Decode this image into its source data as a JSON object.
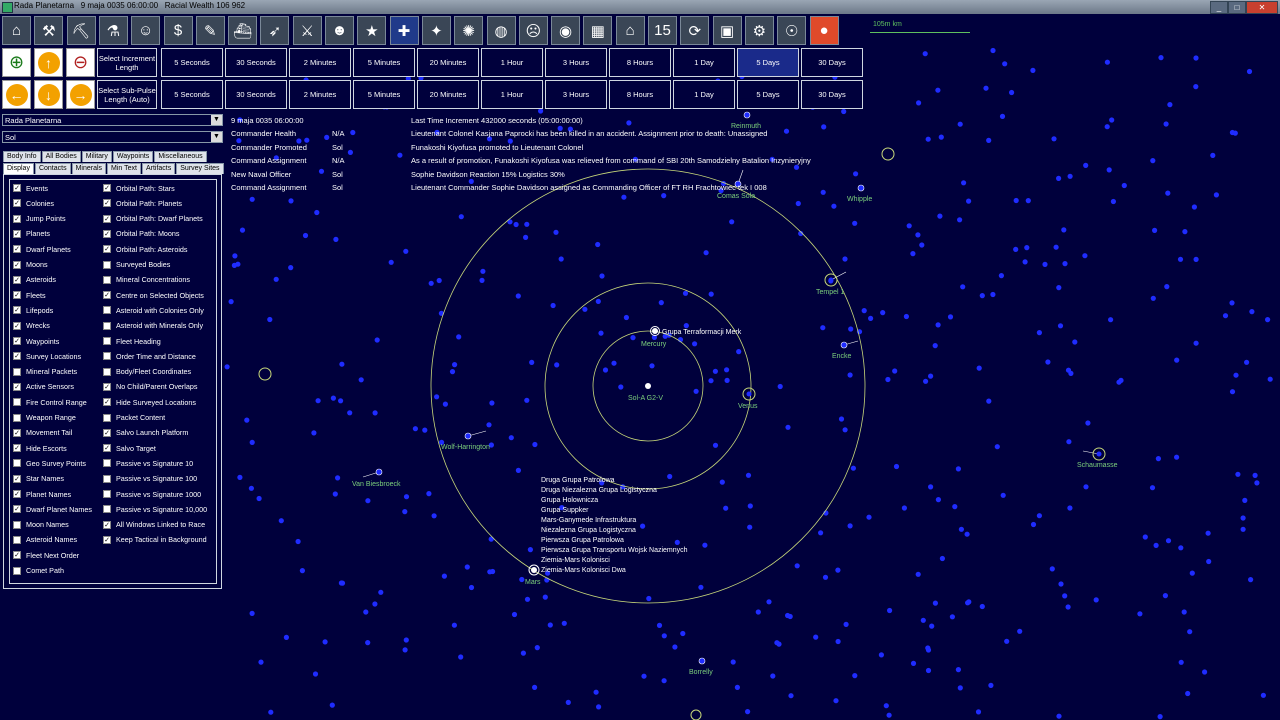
{
  "window": {
    "title": "Rada Planetarna   9 maja 0035 06:00:00   Racial Wealth 106 962",
    "controls": [
      "_",
      "□",
      "✕"
    ]
  },
  "toolbar": {
    "icons": [
      "colony-icon",
      "industry-icon",
      "mining-icon",
      "research-icon",
      "population-icon",
      "economics-icon",
      "design-icon",
      "ship-design-icon",
      "missile-icon",
      "ground-forces-icon",
      "commanders-icon",
      "medals-icon",
      "flag-icon",
      "system-map-icon",
      "galaxy-map-icon",
      "globe-icon",
      "species-icon",
      "intelligence-icon",
      "ship-card-icon",
      "academy-icon",
      "calendar-icon",
      "refresh-icon",
      "save-icon",
      "settings-icon",
      "alien-icon",
      "stop-icon"
    ],
    "glyphs": [
      "⌂",
      "⚒",
      "⛏",
      "⚗",
      "☺",
      "$",
      "✎",
      "⛴",
      "➶",
      "⚔",
      "☻",
      "★",
      "✚",
      "✦",
      "✺",
      "◍",
      "☹",
      "◉",
      "▦",
      "⌂",
      "15",
      "⟳",
      "▣",
      "⚙",
      "☉",
      "●"
    ],
    "scale_label": "105m km"
  },
  "increment_rows": [
    {
      "label": "Select Increment Length",
      "buttons": [
        "5 Seconds",
        "30 Seconds",
        "2 Minutes",
        "5 Minutes",
        "20 Minutes",
        "1 Hour",
        "3 Hours",
        "8 Hours",
        "1 Day",
        "5 Days",
        "30 Days"
      ],
      "active_index": 9
    },
    {
      "label": "Select Sub-Pulse Length (Auto)",
      "buttons": [
        "5 Seconds",
        "30 Seconds",
        "2 Minutes",
        "5 Minutes",
        "20 Minutes",
        "1 Hour",
        "3 Hours",
        "8 Hours",
        "1 Day",
        "5 Days",
        "30 Days"
      ],
      "active_index": -1
    }
  ],
  "selectors": {
    "race": "Rada Planetarna",
    "system": "Sol"
  },
  "tabs_row1": [
    "Body Info",
    "All Bodies",
    "Military",
    "Waypoints",
    "Miscellaneous"
  ],
  "tabs_row2": [
    "Display",
    "Contacts",
    "Minerals",
    "Min Text",
    "Artifacts",
    "Survey Sites"
  ],
  "display_options_col1": [
    {
      "label": "Events",
      "checked": true
    },
    {
      "label": "Colonies",
      "checked": true
    },
    {
      "label": "Jump Points",
      "checked": true
    },
    {
      "label": "Planets",
      "checked": true
    },
    {
      "label": "Dwarf Planets",
      "checked": true
    },
    {
      "label": "Moons",
      "checked": true
    },
    {
      "label": "Asteroids",
      "checked": true
    },
    {
      "label": "Fleets",
      "checked": true
    },
    {
      "label": "Lifepods",
      "checked": true
    },
    {
      "label": "Wrecks",
      "checked": true
    },
    {
      "label": "Waypoints",
      "checked": true
    },
    {
      "label": "Survey Locations",
      "checked": true
    },
    {
      "label": "Mineral Packets",
      "checked": false
    },
    {
      "label": "Active Sensors",
      "checked": true
    },
    {
      "label": "Fire Control Range",
      "checked": false
    },
    {
      "label": "Weapon Range",
      "checked": false
    },
    {
      "label": "Movement Tail",
      "checked": true
    },
    {
      "label": "Hide Escorts",
      "checked": true
    },
    {
      "label": "Geo Survey Points",
      "checked": false
    },
    {
      "label": "Star Names",
      "checked": true
    },
    {
      "label": "Planet Names",
      "checked": true
    },
    {
      "label": "Dwarf Planet Names",
      "checked": true
    },
    {
      "label": "Moon Names",
      "checked": false
    },
    {
      "label": "Asteroid Names",
      "checked": false
    },
    {
      "label": "Fleet Next Order",
      "checked": true
    },
    {
      "label": "Comet Path",
      "checked": false
    }
  ],
  "display_options_col2": [
    {
      "label": "Orbital Path: Stars",
      "checked": true
    },
    {
      "label": "Orbital Path: Planets",
      "checked": true
    },
    {
      "label": "Orbital Path: Dwarf Planets",
      "checked": true
    },
    {
      "label": "Orbital Path: Moons",
      "checked": true
    },
    {
      "label": "Orbital Path: Asteroids",
      "checked": true
    },
    {
      "label": "Surveyed Bodies",
      "checked": false
    },
    {
      "label": "Mineral Concentrations",
      "checked": false
    },
    {
      "label": "Centre on Selected Objects",
      "checked": true
    },
    {
      "label": "Asteroid with Colonies Only",
      "checked": false
    },
    {
      "label": "Asteroid with Minerals Only",
      "checked": false
    },
    {
      "label": "Fleet Heading",
      "checked": false
    },
    {
      "label": "Order Time and Distance",
      "checked": false
    },
    {
      "label": "Body/Fleet Coordinates",
      "checked": false
    },
    {
      "label": "No Child/Parent Overlaps",
      "checked": true
    },
    {
      "label": "Hide Surveyed Locations",
      "checked": true
    },
    {
      "label": "Packet Content",
      "checked": false
    },
    {
      "label": "Salvo Launch Platform",
      "checked": true
    },
    {
      "label": "Salvo Target",
      "checked": true
    },
    {
      "label": "Passive vs Signature 10",
      "checked": false
    },
    {
      "label": "Passive vs Signature 100",
      "checked": false
    },
    {
      "label": "Passive vs Signature 1000",
      "checked": false
    },
    {
      "label": "Passive vs Signature 10,000",
      "checked": false
    },
    {
      "label": "All Windows Linked to Race",
      "checked": true
    },
    {
      "label": "Keep Tactical in Background",
      "checked": true
    }
  ],
  "event_log": [
    {
      "type": "9 maja 0035 06:00:00",
      "location": "",
      "text": "Last Time Increment 432000 seconds (05:00:00:00)"
    },
    {
      "type": "Commander Health",
      "location": "N/A",
      "text": "Lieutenant Colonel Kasjana Paprocki has been killed in an accident. Assignment prior to death: Unassigned"
    },
    {
      "type": "Commander Promoted",
      "location": "Sol",
      "text": "Funakoshi Kiyofusa promoted to Lieutenant Colonel"
    },
    {
      "type": "Command Assignment",
      "location": "N/A",
      "text": "As a result of promotion, Funakoshi Kiyofusa was relieved from command of SBI 20th Samodzielny Batalion Inzynieryjny"
    },
    {
      "type": "New Naval Officer",
      "location": "Sol",
      "text": "Sophie Davidson   Reaction 15%    Logistics 30%"
    },
    {
      "type": "Command Assignment",
      "location": "Sol",
      "text": "Lieutenant Commander Sophie Davidson assigned as Commanding Officer of FT RH Frachtowiec tek I 008"
    }
  ],
  "map": {
    "star_label": "Sol-A G2-V",
    "planets": [
      "Mercury",
      "Venus",
      "Mars"
    ],
    "comets": [
      "Reinmuth",
      "Comas Sola",
      "Whipple",
      "Tempel 1",
      "Encke",
      "Schaumasse",
      "Wolf-Harrington",
      "Van Biesbroeck",
      "Borrelly"
    ],
    "fleet_near_mercury": "Grupa Terraformacji Merk",
    "fleets_near_mars": [
      "Druga Grupa Patrolowa",
      "Druga Niezalezna Grupa Logistyczna",
      "Grupa Holownicza",
      "Grupa Suppker",
      "Mars-Ganymede Infrastruktura",
      "Niezalezna Grupa Logistyczna",
      "Pierwsza Grupa Patrolowa",
      "Pierwsza Grupa Transportu Wojsk Naziemnych",
      "Ziemia-Mars Kolonisci",
      "Ziemia-Mars Kolonisci Dwa"
    ],
    "orbit_color": "#c8d87a",
    "label_color": "#7cd07c",
    "dot_color": "#1f2cff"
  }
}
